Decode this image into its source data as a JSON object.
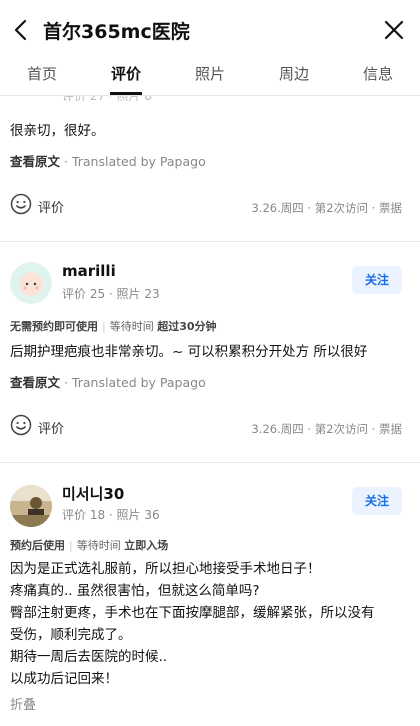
{
  "header": {
    "title": "首尔365mc医院"
  },
  "tabs": [
    {
      "label": "首页"
    },
    {
      "label": "评价"
    },
    {
      "label": "照片"
    },
    {
      "label": "周边"
    },
    {
      "label": "信息"
    }
  ],
  "review0": {
    "stats_partial": "评价 27 · 照片 8",
    "text": "很亲切，很好。",
    "view_original": "查看原文",
    "translated_by": " · Translated by Papago",
    "eval_label": "评价",
    "visit_info": "3.26.周四 · 第2次访问 · 票据"
  },
  "review1": {
    "username": "marilli",
    "stats": "评价 25 · 照片 23",
    "follow": "关注",
    "meta_a": "无需预约即可使用",
    "meta_b": "等待时间",
    "meta_c": "超过30分钟",
    "text": "后期护理疤痕也非常亲切。~ 可以积累积分开处方 所以很好",
    "view_original": "查看原文",
    "translated_by": " · Translated by Papago",
    "eval_label": "评价",
    "visit_info": "3.26.周四 · 第2次访问 · 票据"
  },
  "review2": {
    "username": "미서니30",
    "stats": "评价 18 · 照片 36",
    "follow": "关注",
    "meta_a": "预约后使用",
    "meta_b": "等待时间",
    "meta_c": "立即入场",
    "lines": [
      "因为是正式选礼服前，所以担心地接受手术地日子！",
      "疼痛真的.. 虽然很害怕，但就这么简单吗?",
      "臀部注射更疼，手术也在下面按摩腿部，缓解紧张，所以没有",
      "受伤，顺利完成了。",
      "期待一周后去医院的时候..",
      "以成功后记回来！"
    ],
    "fold": "折叠"
  }
}
